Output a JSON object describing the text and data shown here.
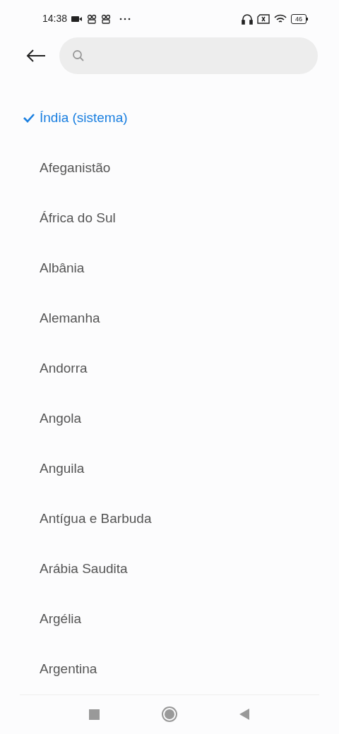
{
  "status_bar": {
    "time": "14:38",
    "battery": "46"
  },
  "countries": [
    {
      "name": "Índia (sistema)",
      "selected": true
    },
    {
      "name": "Afeganistão",
      "selected": false
    },
    {
      "name": "África do Sul",
      "selected": false
    },
    {
      "name": "Albânia",
      "selected": false
    },
    {
      "name": "Alemanha",
      "selected": false
    },
    {
      "name": "Andorra",
      "selected": false
    },
    {
      "name": "Angola",
      "selected": false
    },
    {
      "name": "Anguila",
      "selected": false
    },
    {
      "name": "Antígua e Barbuda",
      "selected": false
    },
    {
      "name": "Arábia Saudita",
      "selected": false
    },
    {
      "name": "Argélia",
      "selected": false
    },
    {
      "name": "Argentina",
      "selected": false
    }
  ]
}
